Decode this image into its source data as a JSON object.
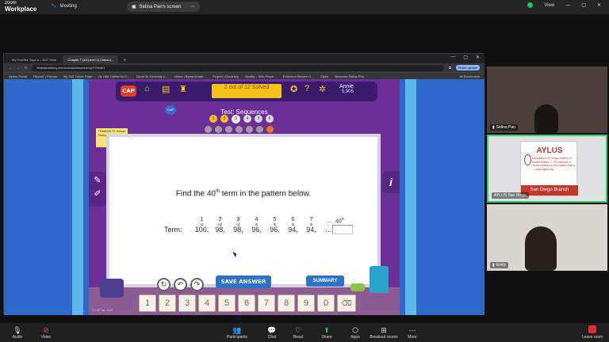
{
  "zoom": {
    "logo_line1": "zoom",
    "logo_line2": "Workplace",
    "meeting_label": "Meeting",
    "share_pill": "Selina Pan's screen",
    "view_label": "View",
    "bottom": [
      {
        "label": "Audio",
        "icon": "microphone-icon"
      },
      {
        "label": "Video",
        "icon": "camera-off-icon"
      },
      {
        "label": "Participants",
        "icon": "people-icon"
      },
      {
        "label": "Chat",
        "icon": "chat-icon"
      },
      {
        "label": "React",
        "icon": "heart-icon"
      },
      {
        "label": "Share",
        "icon": "share-icon"
      },
      {
        "label": "Apps",
        "icon": "apps-icon"
      },
      {
        "label": "Breakout rooms",
        "icon": "grid-icon"
      },
      {
        "label": "More",
        "icon": "more-icon"
      }
    ],
    "participants_count": "1",
    "leave_label": "Leave room"
  },
  "browser": {
    "tabs": [
      {
        "label": "My Practice Sign in – SAT Suite"
      },
      {
        "label": "Chapter 7 (18 Level 1) Classro…"
      }
    ],
    "url": "beastacademy.com/school/classroom/y7/7/test/1",
    "finish_update": "Finish update",
    "bookmarks": [
      "Aeries Portal",
      "Discord | Friends",
      "My SAT Home Page",
      "HL HBL California G…",
      "David M. Kennedy s…",
      "Home | Beast Acade…",
      "Project | Oscarkey",
      "Spotify – Web Playe…",
      "Princeton Review O…",
      "Chan",
      "Welcome Selina Pan"
    ],
    "all_bookmarks": "All Bookmarks"
  },
  "game": {
    "logo": "CAP",
    "progress": "2 out of 12 Solved",
    "user_name": "Annie",
    "user_coins": "5,905",
    "badge_small": "CAP",
    "test_title": "Test: Sequences",
    "circles": [
      {
        "label": "1",
        "state": "done"
      },
      {
        "label": "2",
        "state": "done"
      },
      {
        "label": "3",
        "state": "current"
      },
      {
        "label": "4",
        "state": "todo"
      },
      {
        "label": "5",
        "state": "todo"
      },
      {
        "label": "6",
        "state": "todo"
      }
    ],
    "badge_text": "TEAMBUILTR Snooze Testing Testing Pieces",
    "question_pre": "Find the 40",
    "question_sup": "th",
    "question_post": " term in the pattern below.",
    "indices": [
      {
        "n": "1",
        "s": "st"
      },
      {
        "n": "2",
        "s": "nd"
      },
      {
        "n": "3",
        "s": "rd"
      },
      {
        "n": "4",
        "s": "th"
      },
      {
        "n": "5",
        "s": "th"
      },
      {
        "n": "6",
        "s": "th"
      },
      {
        "n": "7",
        "s": "th"
      },
      {
        "n": "…",
        "s": ""
      }
    ],
    "index_40": "40",
    "index_40_sup": "th",
    "term_label": "Term:",
    "terms": [
      "100,",
      "98,",
      "98,",
      "96,",
      "96,",
      "94,",
      "94,",
      "…,"
    ],
    "save_answer": "SAVE ANSWER",
    "summary": "SUMMARY",
    "keys": [
      "1",
      "2",
      "3",
      "4",
      "5",
      "6",
      "7",
      "8",
      "9",
      "0"
    ],
    "backspace": "⌫",
    "copyright": "© CAP Inc. 2024"
  },
  "video": {
    "p1": "Selina Pan",
    "p2": "AYLUS San Diego",
    "p3": "Emily",
    "aylus_title": "AYLUS",
    "aylus_sub": "Association of Young Leaders in United States — The Alliance of Youth Leaders in the United States — www.aylus.org",
    "aylus_branch": "San Diego Branch"
  },
  "colors": {
    "zoom_share_green": "#23c552",
    "game_purple": "#6c2f98",
    "page_blue": "#2e69c9",
    "button_blue": "#2f73c8",
    "gold": "#f5c21c",
    "aylus_red": "#c0392b"
  }
}
